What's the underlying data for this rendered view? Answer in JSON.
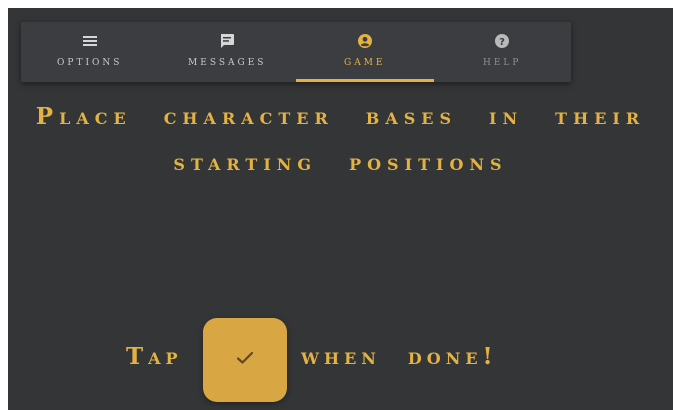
{
  "nav": {
    "items": [
      {
        "label": "OPTIONS",
        "icon": "menu-icon"
      },
      {
        "label": "MESSAGES",
        "icon": "message-icon"
      },
      {
        "label": "GAME",
        "icon": "user-icon"
      },
      {
        "label": "HELP",
        "icon": "help-icon"
      }
    ],
    "active": "GAME"
  },
  "instruction": {
    "headline": "Place character bases in their starting positions",
    "tap": "Tap",
    "when_done": "when done!"
  },
  "done_button": {
    "icon": "check-icon"
  },
  "colors": {
    "background": "#343537",
    "navbar": "#3c3d40",
    "accent": "#e3b243",
    "button": "#d9a644"
  }
}
